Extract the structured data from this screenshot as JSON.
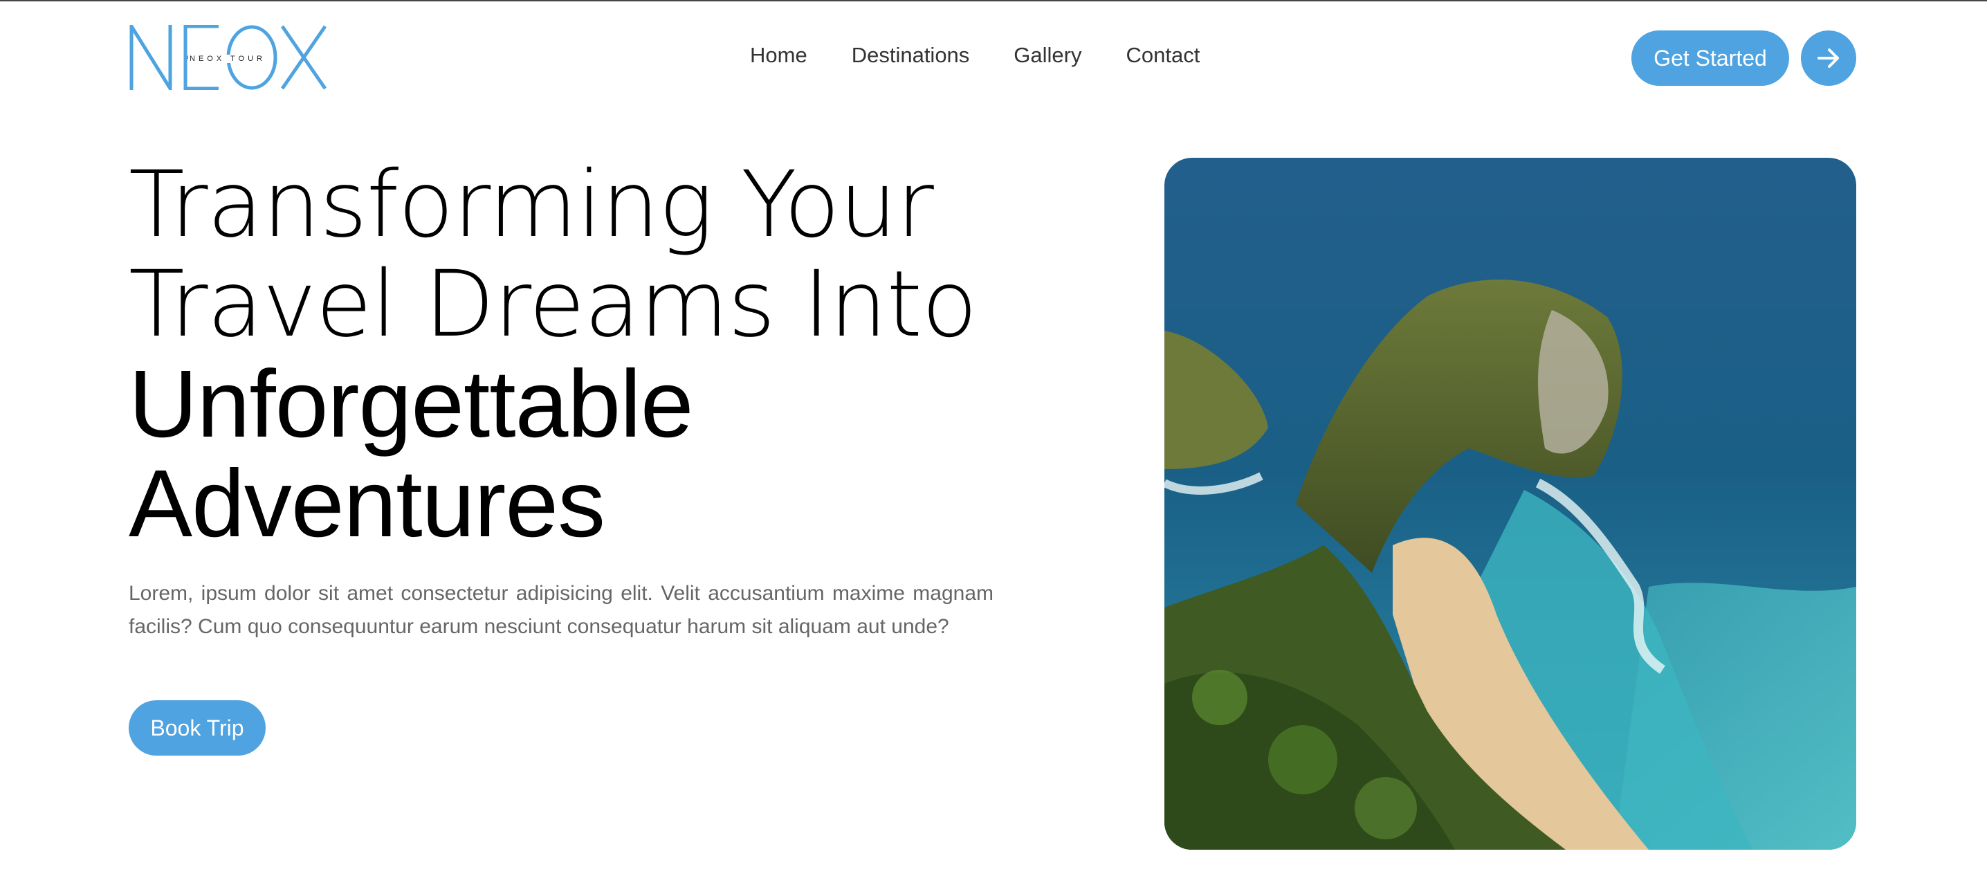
{
  "logo": {
    "wordmark": "NEOX",
    "tagline": "NEOX TOUR",
    "color": "#4ea3e0"
  },
  "nav": {
    "items": [
      {
        "label": "Home"
      },
      {
        "label": "Destinations"
      },
      {
        "label": "Gallery"
      },
      {
        "label": "Contact"
      }
    ]
  },
  "header": {
    "cta_label": "Get Started",
    "arrow_icon": "arrow-right-icon"
  },
  "hero": {
    "title_line1": "Transforming Your",
    "title_line2": "Travel Dreams Into",
    "title_line3": "Unforgettable",
    "title_line4": "Adventures",
    "description": "Lorem, ipsum dolor sit amet consectetur adipisicing elit. Velit accusantium maxime magnam facilis? Cum quo consequuntur earum nesciunt consequatur harum sit aliquam aut unde?",
    "button_label": "Book Trip",
    "image_subject": "coastal-cliff-beach-photo"
  },
  "colors": {
    "accent": "#4ea3e0",
    "text_dark": "#000000",
    "text_muted": "#666666"
  }
}
